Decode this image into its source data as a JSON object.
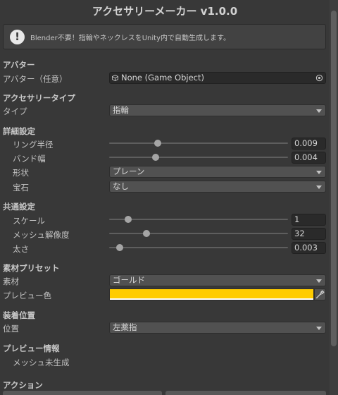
{
  "window": {
    "title": "アクセサリーメーカー v1.0.0"
  },
  "help": {
    "text": "Blender不要！指輪やネックレスをUnity内で自動生成します。",
    "icon": "info-icon"
  },
  "avatar": {
    "section": "アバター",
    "field_label": "アバター（任意）",
    "field_value": "None (Game Object)"
  },
  "accessory_type": {
    "section": "アクセサリータイプ",
    "type_label": "タイプ",
    "type_value": "指輪"
  },
  "details": {
    "section": "詳細設定",
    "ring_radius": {
      "label": "リング半径",
      "value": "0.009",
      "fraction": 0.27
    },
    "band_width": {
      "label": "バンド幅",
      "value": "0.004",
      "fraction": 0.26
    },
    "shape": {
      "label": "形状",
      "value": "プレーン"
    },
    "gem": {
      "label": "宝石",
      "value": "なし"
    }
  },
  "common": {
    "section": "共通設定",
    "scale": {
      "label": "スケール",
      "value": "1",
      "fraction": 0.105
    },
    "mesh_resolution": {
      "label": "メッシュ解像度",
      "value": "32",
      "fraction": 0.21
    },
    "thickness": {
      "label": "太さ",
      "value": "0.003",
      "fraction": 0.058
    }
  },
  "material_preset": {
    "section": "素材プリセット",
    "material_label": "素材",
    "material_value": "ゴールド",
    "preview_color_label": "プレビュー色",
    "preview_color": "#ffcc00"
  },
  "attach": {
    "section": "装着位置",
    "position_label": "位置",
    "position_value": "左薬指"
  },
  "preview_info": {
    "section": "プレビュー情報",
    "status": "メッシュ未生成"
  },
  "actions": {
    "section": "アクション"
  }
}
